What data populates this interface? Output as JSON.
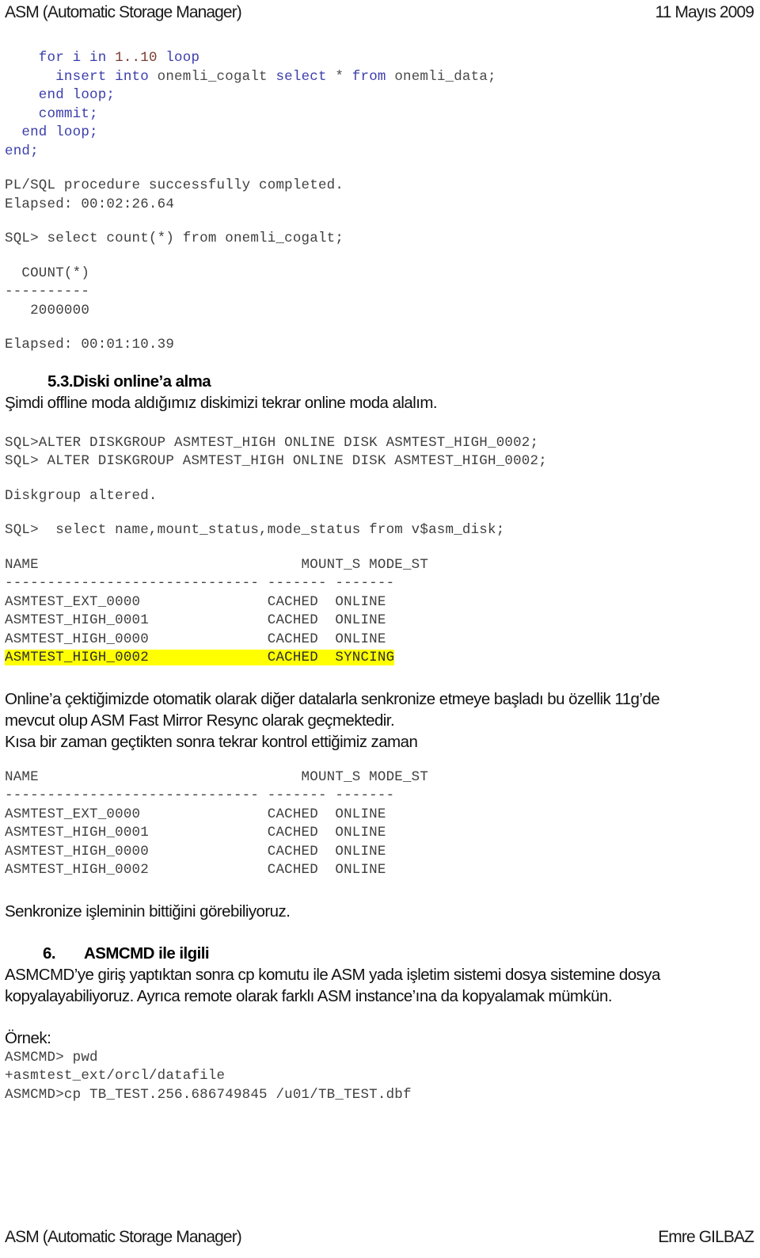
{
  "header": {
    "left": "ASM (Automatic Storage Manager)",
    "right": "11 Mayıs 2009"
  },
  "footer": {
    "left": "ASM (Automatic Storage Manager)",
    "right": "Emre GILBAZ"
  },
  "code_block_1": {
    "line1_kw_for": "    for",
    "line1_var": " i in ",
    "line1_num": "1..10",
    "line1_kw_loop": " loop",
    "line2_kw_insert": "      insert into ",
    "line2_obj": "onemli_cogalt ",
    "line2_kw_select": "select ",
    "line2_star": "* ",
    "line2_kw_from": "from ",
    "line2_obj2": "onemli_data;",
    "line3": "    end loop;",
    "line4": "    commit;",
    "line5": "  end loop;",
    "line6": "end;"
  },
  "console_1": {
    "l1": "PL/SQL procedure successfully completed.",
    "l2": "Elapsed: 00:02:26.64",
    "l3": "SQL> select count(*) from onemli_cogalt;",
    "l4": "  COUNT(*)",
    "l5": "----------",
    "l6": "   2000000",
    "l7": "Elapsed: 00:01:10.39"
  },
  "section_53": {
    "number": "5.3.",
    "title": "Diski online’a alma",
    "intro": "Şimdi offline moda aldığımız diskimizi tekrar online moda alalım."
  },
  "console_2": {
    "l1": "SQL>ALTER DISKGROUP ASMTEST_HIGH ONLINE DISK ASMTEST_HIGH_0002;",
    "l2": "SQL> ALTER DISKGROUP ASMTEST_HIGH ONLINE DISK ASMTEST_HIGH_0002;",
    "l3": "Diskgroup altered.",
    "l4": "SQL>  select name,mount_status,mode_status from v$asm_disk;"
  },
  "table_1": {
    "header": "NAME                               MOUNT_S MODE_ST",
    "rule": "------------------------------ ------- -------",
    "rows": [
      {
        "text": "ASMTEST_EXT_0000               CACHED  ONLINE",
        "highlight": false
      },
      {
        "text": "ASMTEST_HIGH_0001              CACHED  ONLINE",
        "highlight": false
      },
      {
        "text": "ASMTEST_HIGH_0000              CACHED  ONLINE",
        "highlight": false
      },
      {
        "text": "ASMTEST_HIGH_0002              CACHED  SYNCING",
        "highlight": true
      }
    ]
  },
  "paragraph_1": {
    "l1": "Online’a çektiğimizde otomatik olarak diğer datalarla senkronize etmeye başladı bu özellik 11g’de",
    "l2": "mevcut olup ASM Fast Mirror Resync olarak geçmektedir.",
    "l3": "Kısa bir zaman geçtikten sonra tekrar kontrol ettiğimiz zaman"
  },
  "table_2": {
    "header": "NAME                               MOUNT_S MODE_ST",
    "rule": "------------------------------ ------- -------",
    "rows": [
      {
        "text": "ASMTEST_EXT_0000               CACHED  ONLINE",
        "highlight": false
      },
      {
        "text": "ASMTEST_HIGH_0001              CACHED  ONLINE",
        "highlight": false
      },
      {
        "text": "ASMTEST_HIGH_0000              CACHED  ONLINE",
        "highlight": false
      },
      {
        "text": "ASMTEST_HIGH_0002              CACHED  ONLINE",
        "highlight": false
      }
    ]
  },
  "paragraph_2": {
    "l1": "Senkronize işleminin bittiğini görebiliyoruz."
  },
  "section_6": {
    "number": "6.",
    "title": "ASMCMD ile ilgili",
    "l1": "ASMCMD’ye giriş yaptıktan sonra cp komutu ile ASM yada işletim sistemi dosya sistemine dosya",
    "l2": "kopyalayabiliyoruz. Ayrıca remote olarak farklı ASM instance’ına da kopyalamak mümkün."
  },
  "example": {
    "label": "Örnek:",
    "l1": "ASMCMD> pwd",
    "l2": "+asmtest_ext/orcl/datafile",
    "l3": "ASMCMD>cp TB_TEST.256.686749845 /u01/TB_TEST.dbf"
  },
  "colors": {
    "keyword": "#3b3eac",
    "number": "#7a3b2e",
    "highlight": "#ffff00",
    "console": "#3f3f3f"
  }
}
